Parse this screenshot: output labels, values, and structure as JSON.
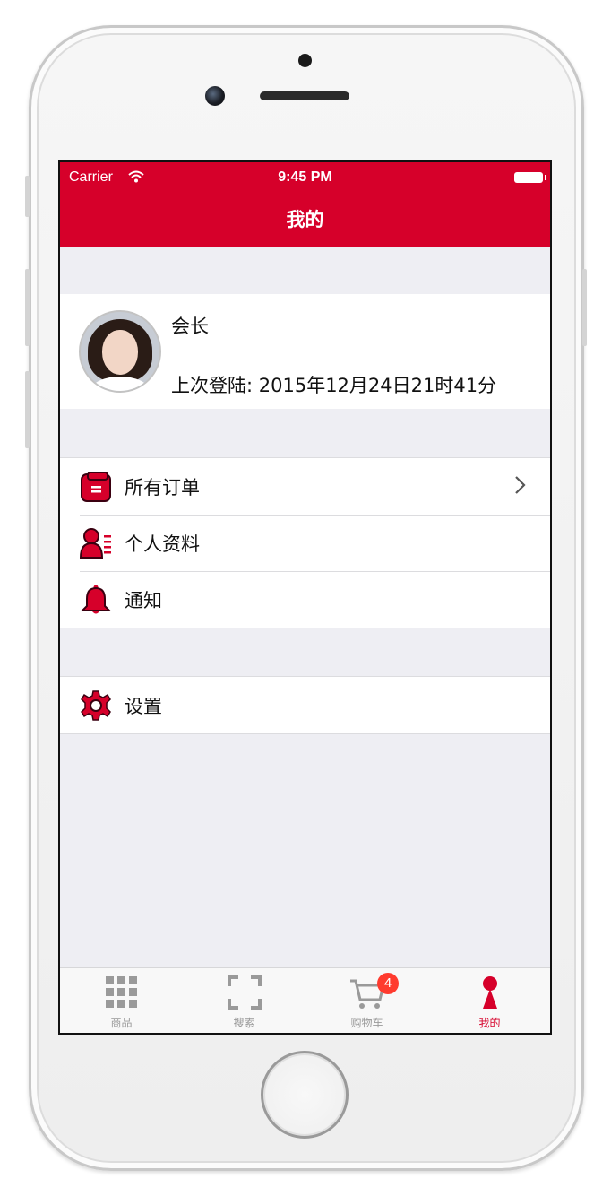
{
  "status_bar": {
    "carrier": "Carrier",
    "time": "9:45 PM"
  },
  "nav": {
    "title": "我的"
  },
  "profile": {
    "name": "会长",
    "last_login": "上次登陆: 2015年12月24日21时41分"
  },
  "menu_groups": [
    {
      "items": [
        {
          "label": "所有订单",
          "icon": "orders-icon",
          "chevron": true
        },
        {
          "label": "个人资料",
          "icon": "profile-card-icon",
          "chevron": false
        },
        {
          "label": "通知",
          "icon": "bell-icon",
          "chevron": false
        }
      ]
    },
    {
      "items": [
        {
          "label": "设置",
          "icon": "gear-icon",
          "chevron": false
        }
      ]
    }
  ],
  "tabbar": {
    "tabs": [
      {
        "label": "商品",
        "icon": "grid-icon",
        "active": false
      },
      {
        "label": "搜索",
        "icon": "scan-icon",
        "active": false
      },
      {
        "label": "购物车",
        "icon": "cart-icon",
        "active": false
      },
      {
        "label": "我的",
        "icon": "person-icon",
        "active": true
      }
    ],
    "cart_badge": "4"
  },
  "colors": {
    "brand_red": "#d6002a",
    "background": "#eeeef3",
    "tab_inactive": "#9a9a9a",
    "badge": "#ff3b2f"
  }
}
